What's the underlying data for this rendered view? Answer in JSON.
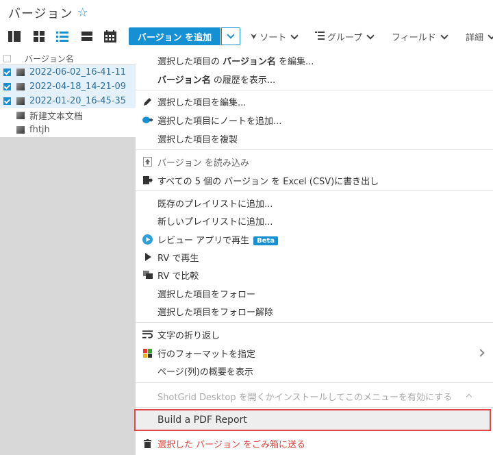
{
  "header": {
    "title": "バージョン",
    "favorite_icon": "star-icon"
  },
  "toolbar": {
    "add_button": "バージョン を追加",
    "sort": "ソート",
    "group": "グループ",
    "fields": "フィールド",
    "details": "詳細"
  },
  "list": {
    "column_header": "バージョン名",
    "rows": [
      {
        "name": "2022-06-02_16-41-11",
        "checked": true
      },
      {
        "name": "2022-04-18_14-21-09",
        "checked": true
      },
      {
        "name": "2022-01-20_16-45-35",
        "checked": true
      },
      {
        "name": "新建文本文档",
        "checked": false
      },
      {
        "name": "fhtjh",
        "checked": false
      }
    ]
  },
  "menu": {
    "edit_name_pre": "選択した項目の ",
    "edit_name_bold": "バージョン名",
    "edit_name_post": " を編集...",
    "history_bold": "バージョン名",
    "history_post": " の履歴を表示...",
    "edit_selected": "選択した項目を編集...",
    "add_note": "選択した項目にノートを追加...",
    "duplicate": "選択した項目を複製",
    "import": "バージョン を読み込み",
    "export": "すべての 5 個の バージョン を Excel (CSV)に書き出し",
    "add_existing_playlist": "既存のプレイリストに追加...",
    "add_new_playlist": "新しいプレイリストに追加...",
    "review_app": "レビュー アプリで再生",
    "beta": "Beta",
    "play_rv": "RV で再生",
    "compare_rv": "RV で比較",
    "follow": "選択した項目をフォロー",
    "unfollow": "選択した項目をフォロー解除",
    "wrap_text": "文字の折り返し",
    "format_rows": "行のフォーマットを指定",
    "page_summary": "ページ(列)の概要を表示",
    "desktop_notice": "ShotGrid Desktop を開くかインストールしてこのメニューを有効にする",
    "pdf_report": "Build a PDF Report",
    "trash": "選択した バージョン をごみ箱に送る"
  },
  "colors": {
    "accent": "#1591d3",
    "danger": "#d9453a",
    "highlight_border": "#e04646"
  }
}
